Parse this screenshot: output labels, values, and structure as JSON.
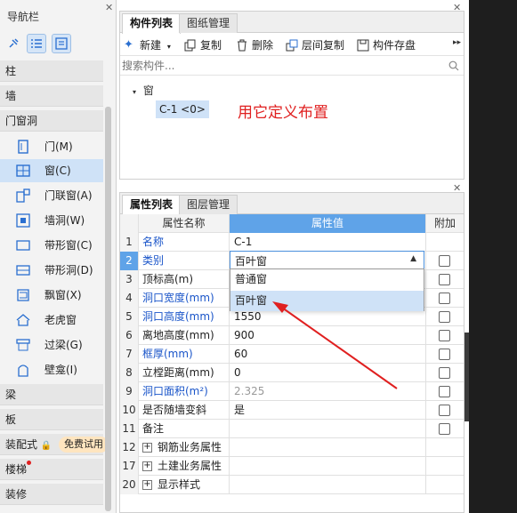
{
  "nav": {
    "title": "导航栏",
    "categories": [
      "柱",
      "墙",
      "门窗洞",
      "梁",
      "板",
      "装配式",
      "楼梯",
      "装修"
    ],
    "items": [
      "门(M)",
      "窗(C)",
      "门联窗(A)",
      "墙洞(W)",
      "带形窗(C)",
      "带形洞(D)",
      "飘窗(X)",
      "老虎窗",
      "过梁(G)",
      "壁龛(I)"
    ],
    "trial_badge": "免费试用"
  },
  "components": {
    "tabs": [
      "构件列表",
      "图纸管理"
    ],
    "toolbar": {
      "new": "新建",
      "copy": "复制",
      "delete": "删除",
      "layer_copy": "层间复制",
      "save": "构件存盘"
    },
    "search_placeholder": "搜索构件...",
    "tree_root": "窗",
    "tree_item": "C-1 <0>",
    "annotation": "用它定义布置"
  },
  "properties": {
    "tabs": [
      "属性列表",
      "图层管理"
    ],
    "header": {
      "name": "属性名称",
      "value": "属性值",
      "add": "附加"
    },
    "rows": [
      {
        "num": "1",
        "name": "名称",
        "value": "C-1"
      },
      {
        "num": "2",
        "name": "类别",
        "value": "百叶窗"
      },
      {
        "num": "3",
        "name": "顶标高(m)",
        "value": ""
      },
      {
        "num": "4",
        "name": "洞口宽度(mm)",
        "value": ""
      },
      {
        "num": "5",
        "name": "洞口高度(mm)",
        "value": "1550"
      },
      {
        "num": "6",
        "name": "离地高度(mm)",
        "value": "900"
      },
      {
        "num": "7",
        "name": "框厚(mm)",
        "value": "60"
      },
      {
        "num": "8",
        "name": "立樘距离(mm)",
        "value": "0"
      },
      {
        "num": "9",
        "name": "洞口面积(m²)",
        "value": "2.325"
      },
      {
        "num": "10",
        "name": "是否随墙变斜",
        "value": "是"
      },
      {
        "num": "11",
        "name": "备注",
        "value": ""
      },
      {
        "num": "12",
        "name": "钢筋业务属性",
        "value": ""
      },
      {
        "num": "17",
        "name": "土建业务属性",
        "value": ""
      },
      {
        "num": "20",
        "name": "显示样式",
        "value": ""
      }
    ],
    "dropdown_options": [
      "普通窗",
      "百叶窗"
    ]
  },
  "colors": {
    "accent": "#5fa3e8",
    "blue_text": "#1a55c9",
    "annotation": "#e02020"
  }
}
